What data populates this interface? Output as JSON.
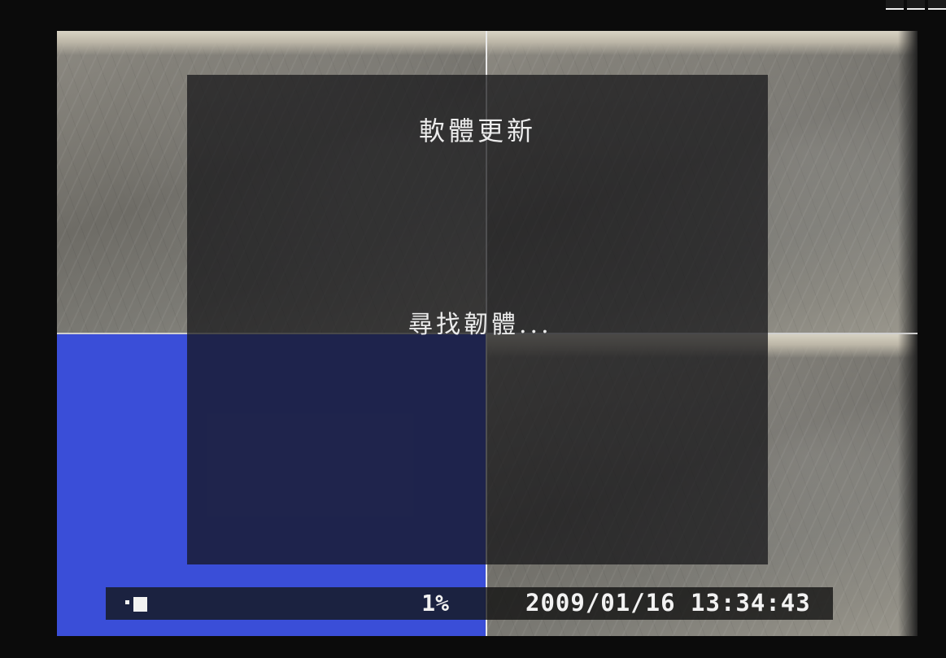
{
  "dialog": {
    "title": "軟體更新",
    "message": "尋找韌體..."
  },
  "status_bar": {
    "disk_usage": "1%",
    "datetime": "2009/01/16 13:34:43",
    "disk_icon": "hdd-icon"
  },
  "colors": {
    "blue_feed": "#3a4ed8",
    "status_left": "#1b2240",
    "text": "#f2f2f2"
  },
  "layout_mode": "quad-view"
}
